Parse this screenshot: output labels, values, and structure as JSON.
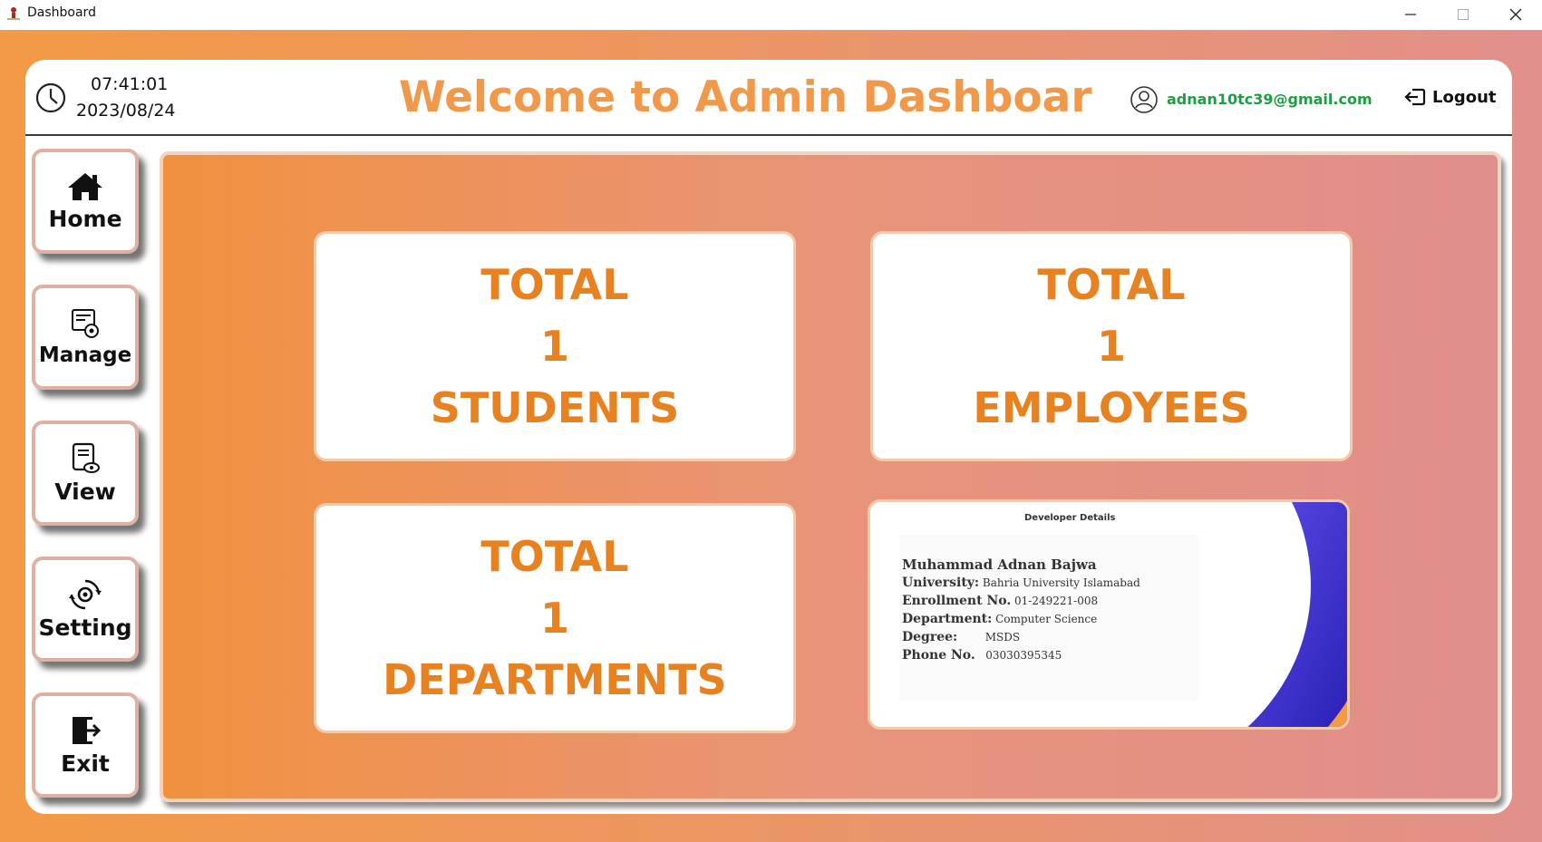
{
  "window": {
    "title": "Dashboard"
  },
  "header": {
    "time": "07:41:01",
    "date": "2023/08/24",
    "welcome": "Welcome to Admin Dashboar",
    "user_email": "adnan10tc39@gmail.com",
    "logout_label": "Logout"
  },
  "sidebar": {
    "items": [
      {
        "label": "Home",
        "icon": "home-icon"
      },
      {
        "label": "Manage",
        "icon": "manage-icon"
      },
      {
        "label": "View",
        "icon": "view-icon"
      },
      {
        "label": "Setting",
        "icon": "setting-icon"
      },
      {
        "label": "Exit",
        "icon": "exit-icon"
      }
    ]
  },
  "cards": [
    {
      "line1": "TOTAL",
      "count": "1",
      "line3": "STUDENTS"
    },
    {
      "line1": "TOTAL",
      "count": "1",
      "line3": "EMPLOYEES"
    },
    {
      "line1": "TOTAL",
      "count": "1",
      "line3": "DEPARTMENTS"
    }
  ],
  "developer": {
    "title": "Developer Details",
    "name": "Muhammad Adnan Bajwa",
    "university_label": "University:",
    "university": "Bahria University Islamabad",
    "enrollment_label": "Enrollment No.",
    "enrollment": "01-249221-008",
    "department_label": "Department:",
    "department": "Computer Science",
    "degree_label": "Degree:",
    "degree": "MSDS",
    "phone_label": "Phone No.",
    "phone": "03030395345"
  },
  "colors": {
    "accent_orange": "#f0994a",
    "card_text": "#e8811f",
    "email_green": "#1aa043"
  }
}
